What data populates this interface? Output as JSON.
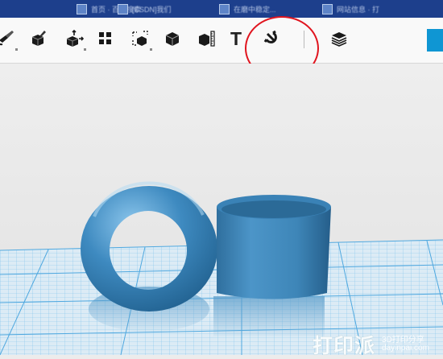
{
  "browser": {
    "tabs": [
      {
        "label": "首页 · 百度搜索"
      },
      {
        "label": "[CSDN]我们"
      },
      {
        "label": "在磨中稳定..."
      },
      {
        "label": "网站信息 · 打"
      }
    ]
  },
  "toolbar": {
    "tools": [
      {
        "icon": "smooth-brush-icon"
      },
      {
        "icon": "paint-brush-icon"
      },
      {
        "icon": "transform-move-icon"
      },
      {
        "icon": "group-objects-icon"
      },
      {
        "icon": "mesh-select-icon"
      },
      {
        "icon": "solid-cube-icon"
      },
      {
        "icon": "measure-ruler-icon"
      },
      {
        "icon": "text-icon",
        "label": "T"
      },
      {
        "icon": "magnet-snap-icon"
      },
      {
        "icon": "layer-stack-icon"
      }
    ],
    "accent_color": "#0f96d3",
    "highlight_color": "#e0141e"
  },
  "scene": {
    "object_color": "#3d84b5",
    "grid_color": "#7fc3ec",
    "objects": [
      {
        "name": "torus"
      },
      {
        "name": "cylinder-tube"
      }
    ]
  },
  "watermark": {
    "big_text": "打印派",
    "top_text": "3D打印分享",
    "url": "dayinpai.com"
  }
}
